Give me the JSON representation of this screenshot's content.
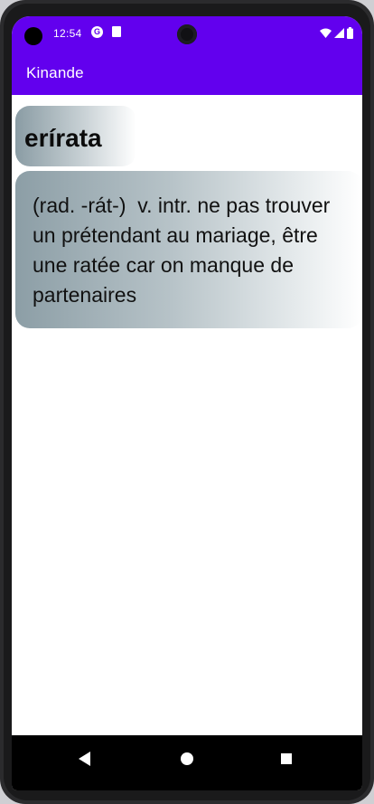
{
  "status_bar": {
    "time": "12:54",
    "icons": [
      "notification-g-icon",
      "sd-card-icon",
      "wifi-icon",
      "signal-icon",
      "battery-icon"
    ]
  },
  "app_bar": {
    "title": "Kinande",
    "color": "#6200ee"
  },
  "entry": {
    "word": "erírata",
    "definition": "(rad. -rát-)  v. intr. ne pas trouver un prétendant au mariage, être une ratée car on manque de partenaires"
  },
  "nav_bar": {
    "icons": [
      "back-icon",
      "home-icon",
      "recents-icon"
    ]
  }
}
